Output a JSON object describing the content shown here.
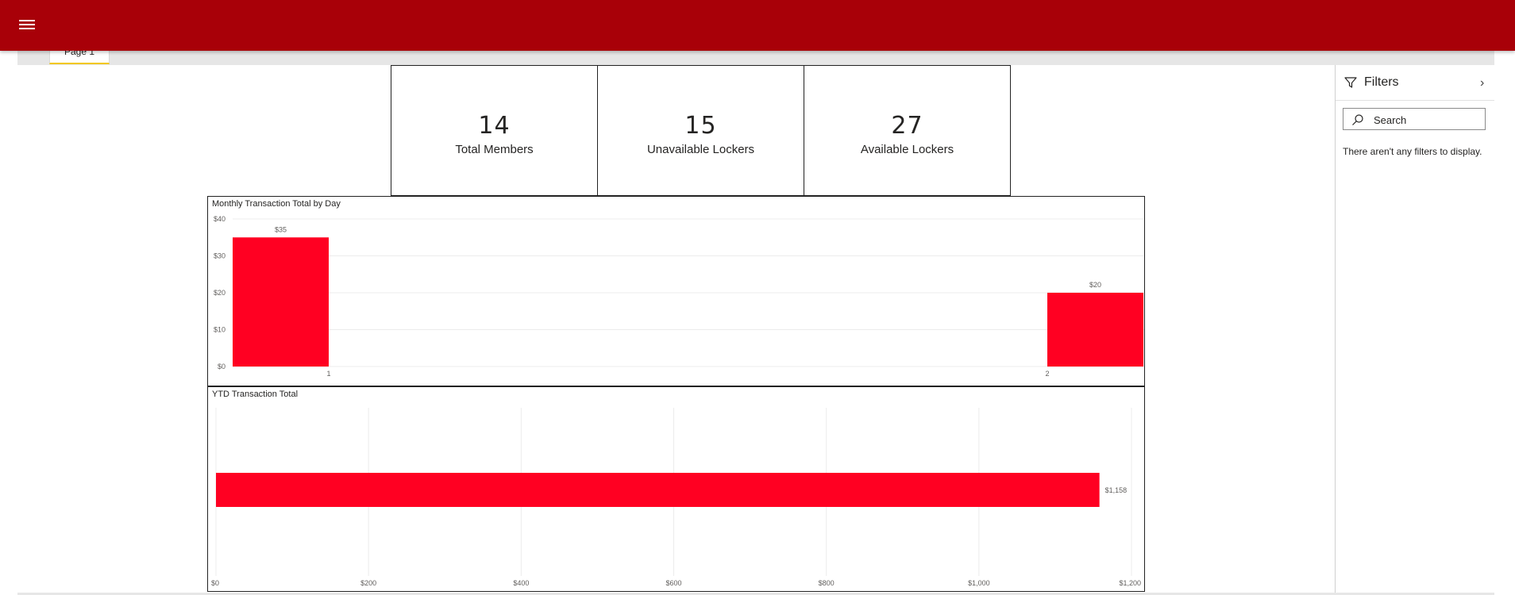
{
  "header": {
    "menu_icon": "hamburger-icon",
    "accent": "#a80008"
  },
  "pages": {
    "tabs": [
      {
        "label": "Page 1",
        "active": true
      }
    ]
  },
  "cards": [
    {
      "value": "14",
      "label": "Total Members"
    },
    {
      "value": "15",
      "label": "Unavailable Lockers"
    },
    {
      "value": "27",
      "label": "Available Lockers"
    }
  ],
  "chart_data": [
    {
      "type": "bar",
      "title": "Monthly Transaction Total by Day",
      "categories": [
        "1",
        "2"
      ],
      "values": [
        35,
        20
      ],
      "data_labels": [
        "$35",
        "$20"
      ],
      "yticks": [
        "$0",
        "$10",
        "$20",
        "$30",
        "$40"
      ],
      "ylim": [
        0,
        40
      ],
      "grid": true,
      "color": "#ff0022"
    },
    {
      "type": "bar",
      "orientation": "horizontal",
      "title": "YTD Transaction Total",
      "values": [
        1158
      ],
      "data_labels": [
        "$1,158"
      ],
      "xticks": [
        "$0",
        "$200",
        "$400",
        "$600",
        "$800",
        "$1,000",
        "$1,200"
      ],
      "xlim": [
        0,
        1200
      ],
      "grid": true,
      "color": "#ff0022"
    }
  ],
  "filters": {
    "title": "Filters",
    "search_placeholder": "Search",
    "empty_message": "There aren't any filters to display.",
    "filter_icon": "filter-icon",
    "collapse_icon": "chevron-right-icon"
  }
}
